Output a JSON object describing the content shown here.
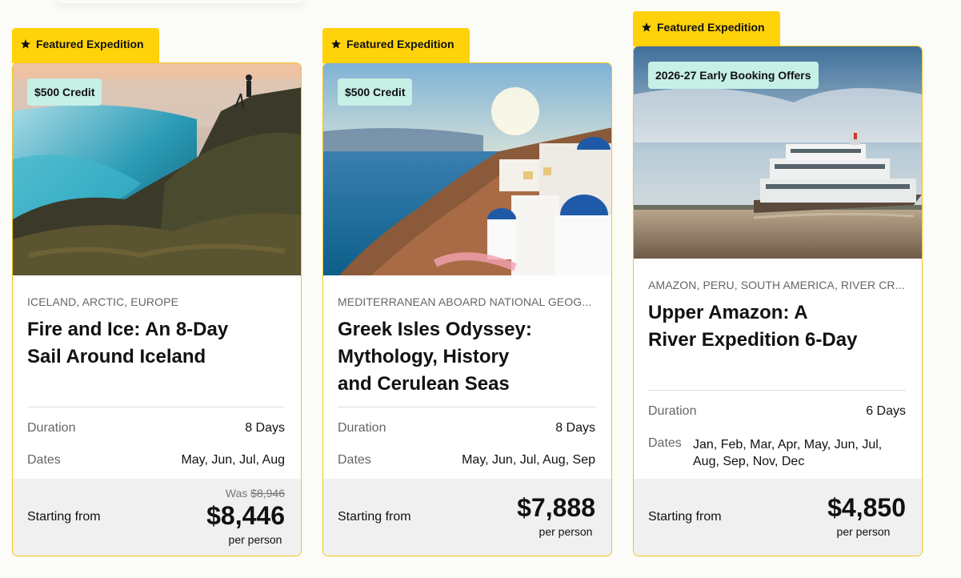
{
  "cards": [
    {
      "ribbon": "Featured Expedition",
      "badge": "$500 Credit",
      "category": "ICELAND, ARCTIC, EUROPE",
      "title_lines": [
        "Fire and Ice: An 8-Day",
        "Sail Around Iceland"
      ],
      "duration_label": "Duration",
      "duration": "8 Days",
      "dates_label": "Dates",
      "dates": "May, Jun, Jul, Aug",
      "was_label": "Was",
      "was_price": "$8,946",
      "starting_label": "Starting from",
      "price": "$8,446",
      "per_person": "per person"
    },
    {
      "ribbon": "Featured Expedition",
      "badge": "$500 Credit",
      "category": "MEDITERRANEAN ABOARD NATIONAL GEOG...",
      "title_lines": [
        "Greek Isles Odyssey:",
        "Mythology, History",
        "and Cerulean Seas"
      ],
      "duration_label": "Duration",
      "duration": "8 Days",
      "dates_label": "Dates",
      "dates": "May, Jun, Jul, Aug, Sep",
      "starting_label": "Starting from",
      "price": "$7,888",
      "per_person": "per person"
    },
    {
      "ribbon": "Featured Expedition",
      "badge": "2026-27 Early Booking Offers",
      "category": "AMAZON, PERU, SOUTH AMERICA, RIVER CR...",
      "title_lines": [
        "Upper Amazon: A",
        "River Expedition 6-Day"
      ],
      "duration_label": "Duration",
      "duration": "6 Days",
      "dates_label": "Dates",
      "dates_lines": [
        "Jan, Feb, Mar, Apr, May, Jun, Jul,",
        "Aug, Sep, Nov, Dec"
      ],
      "starting_label": "Starting from",
      "price": "$4,850",
      "per_person": "per person"
    }
  ],
  "colors": {
    "ribbon": "#ffd20a",
    "badge": "#c6efe6",
    "border": "#f2c61a",
    "price_panel": "#f0f0f0"
  },
  "icons": {
    "ribbon_icon": "star-icon"
  }
}
